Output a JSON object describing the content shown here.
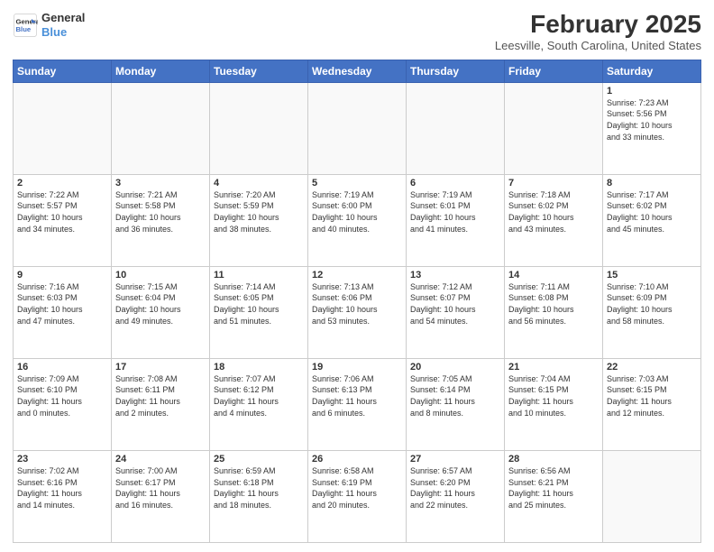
{
  "header": {
    "logo_line1": "General",
    "logo_line2": "Blue",
    "month": "February 2025",
    "location": "Leesville, South Carolina, United States"
  },
  "weekdays": [
    "Sunday",
    "Monday",
    "Tuesday",
    "Wednesday",
    "Thursday",
    "Friday",
    "Saturday"
  ],
  "weeks": [
    [
      {
        "day": "",
        "info": ""
      },
      {
        "day": "",
        "info": ""
      },
      {
        "day": "",
        "info": ""
      },
      {
        "day": "",
        "info": ""
      },
      {
        "day": "",
        "info": ""
      },
      {
        "day": "",
        "info": ""
      },
      {
        "day": "1",
        "info": "Sunrise: 7:23 AM\nSunset: 5:56 PM\nDaylight: 10 hours\nand 33 minutes."
      }
    ],
    [
      {
        "day": "2",
        "info": "Sunrise: 7:22 AM\nSunset: 5:57 PM\nDaylight: 10 hours\nand 34 minutes."
      },
      {
        "day": "3",
        "info": "Sunrise: 7:21 AM\nSunset: 5:58 PM\nDaylight: 10 hours\nand 36 minutes."
      },
      {
        "day": "4",
        "info": "Sunrise: 7:20 AM\nSunset: 5:59 PM\nDaylight: 10 hours\nand 38 minutes."
      },
      {
        "day": "5",
        "info": "Sunrise: 7:19 AM\nSunset: 6:00 PM\nDaylight: 10 hours\nand 40 minutes."
      },
      {
        "day": "6",
        "info": "Sunrise: 7:19 AM\nSunset: 6:01 PM\nDaylight: 10 hours\nand 41 minutes."
      },
      {
        "day": "7",
        "info": "Sunrise: 7:18 AM\nSunset: 6:02 PM\nDaylight: 10 hours\nand 43 minutes."
      },
      {
        "day": "8",
        "info": "Sunrise: 7:17 AM\nSunset: 6:02 PM\nDaylight: 10 hours\nand 45 minutes."
      }
    ],
    [
      {
        "day": "9",
        "info": "Sunrise: 7:16 AM\nSunset: 6:03 PM\nDaylight: 10 hours\nand 47 minutes."
      },
      {
        "day": "10",
        "info": "Sunrise: 7:15 AM\nSunset: 6:04 PM\nDaylight: 10 hours\nand 49 minutes."
      },
      {
        "day": "11",
        "info": "Sunrise: 7:14 AM\nSunset: 6:05 PM\nDaylight: 10 hours\nand 51 minutes."
      },
      {
        "day": "12",
        "info": "Sunrise: 7:13 AM\nSunset: 6:06 PM\nDaylight: 10 hours\nand 53 minutes."
      },
      {
        "day": "13",
        "info": "Sunrise: 7:12 AM\nSunset: 6:07 PM\nDaylight: 10 hours\nand 54 minutes."
      },
      {
        "day": "14",
        "info": "Sunrise: 7:11 AM\nSunset: 6:08 PM\nDaylight: 10 hours\nand 56 minutes."
      },
      {
        "day": "15",
        "info": "Sunrise: 7:10 AM\nSunset: 6:09 PM\nDaylight: 10 hours\nand 58 minutes."
      }
    ],
    [
      {
        "day": "16",
        "info": "Sunrise: 7:09 AM\nSunset: 6:10 PM\nDaylight: 11 hours\nand 0 minutes."
      },
      {
        "day": "17",
        "info": "Sunrise: 7:08 AM\nSunset: 6:11 PM\nDaylight: 11 hours\nand 2 minutes."
      },
      {
        "day": "18",
        "info": "Sunrise: 7:07 AM\nSunset: 6:12 PM\nDaylight: 11 hours\nand 4 minutes."
      },
      {
        "day": "19",
        "info": "Sunrise: 7:06 AM\nSunset: 6:13 PM\nDaylight: 11 hours\nand 6 minutes."
      },
      {
        "day": "20",
        "info": "Sunrise: 7:05 AM\nSunset: 6:14 PM\nDaylight: 11 hours\nand 8 minutes."
      },
      {
        "day": "21",
        "info": "Sunrise: 7:04 AM\nSunset: 6:15 PM\nDaylight: 11 hours\nand 10 minutes."
      },
      {
        "day": "22",
        "info": "Sunrise: 7:03 AM\nSunset: 6:15 PM\nDaylight: 11 hours\nand 12 minutes."
      }
    ],
    [
      {
        "day": "23",
        "info": "Sunrise: 7:02 AM\nSunset: 6:16 PM\nDaylight: 11 hours\nand 14 minutes."
      },
      {
        "day": "24",
        "info": "Sunrise: 7:00 AM\nSunset: 6:17 PM\nDaylight: 11 hours\nand 16 minutes."
      },
      {
        "day": "25",
        "info": "Sunrise: 6:59 AM\nSunset: 6:18 PM\nDaylight: 11 hours\nand 18 minutes."
      },
      {
        "day": "26",
        "info": "Sunrise: 6:58 AM\nSunset: 6:19 PM\nDaylight: 11 hours\nand 20 minutes."
      },
      {
        "day": "27",
        "info": "Sunrise: 6:57 AM\nSunset: 6:20 PM\nDaylight: 11 hours\nand 22 minutes."
      },
      {
        "day": "28",
        "info": "Sunrise: 6:56 AM\nSunset: 6:21 PM\nDaylight: 11 hours\nand 25 minutes."
      },
      {
        "day": "",
        "info": ""
      }
    ]
  ]
}
